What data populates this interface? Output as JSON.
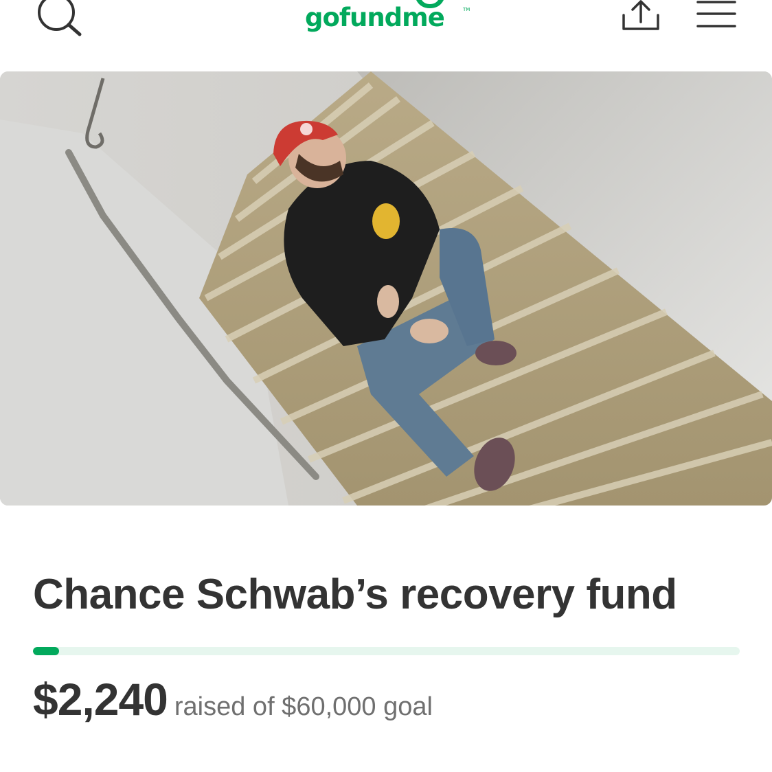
{
  "header": {
    "logo_text": "gofundme",
    "search_icon": "search-icon",
    "share_icon": "share-icon",
    "menu_icon": "hamburger-menu-icon"
  },
  "hero": {
    "image": "photo of a bearded man in a red cap and black sweatshirt sitting on a staircase"
  },
  "campaign": {
    "title": "Chance Schwab’s recovery fund",
    "raised_amount": "$2,240",
    "raised_text": "raised of $60,000 goal",
    "progress_fraction": 0.037
  },
  "colors": {
    "brand_green": "#02a95c",
    "progress_track": "#e6f6ee",
    "title_text": "#333333",
    "secondary_text": "#6f6f6f"
  }
}
